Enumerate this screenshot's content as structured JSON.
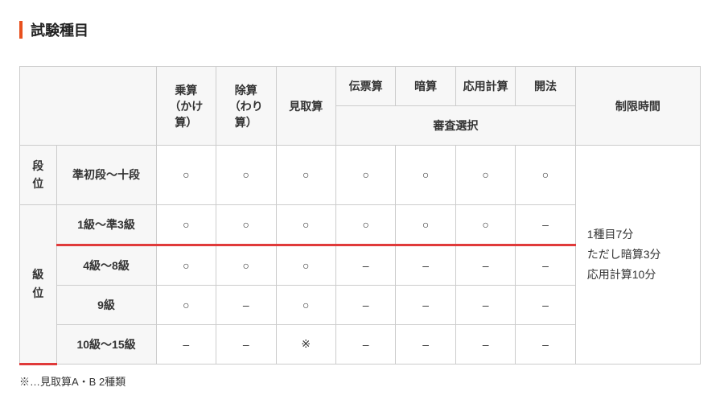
{
  "title": "試験種目",
  "headers": {
    "mult": "乗算\n（かけ算）",
    "div": "除算\n（わり算）",
    "mitori": "見取算",
    "denpyo": "伝票算",
    "anzan": "暗算",
    "ouyou": "応用計算",
    "kaihou": "開法",
    "shinsa": "審査選択",
    "time": "制限時間"
  },
  "sideLabels": {
    "dan": "段\n位",
    "kyu": "級\n位"
  },
  "rows": {
    "r1": {
      "range": "準初段～十段",
      "cells": [
        "○",
        "○",
        "○",
        "○",
        "○",
        "○",
        "○"
      ]
    },
    "r2": {
      "range": "1級～準3級",
      "cells": [
        "○",
        "○",
        "○",
        "○",
        "○",
        "○",
        "–"
      ]
    },
    "r3": {
      "range": "4級～8級",
      "cells": [
        "○",
        "○",
        "○",
        "–",
        "–",
        "–",
        "–"
      ]
    },
    "r4": {
      "range": "9級",
      "cells": [
        "○",
        "–",
        "○",
        "–",
        "–",
        "–",
        "–"
      ]
    },
    "r5": {
      "range": "10級～15級",
      "cells": [
        "–",
        "–",
        "※",
        "–",
        "–",
        "–",
        "–"
      ]
    }
  },
  "timeText": "1種目7分\nただし暗算3分\n応用計算10分",
  "footnote": "※…見取算A・B 2種類"
}
